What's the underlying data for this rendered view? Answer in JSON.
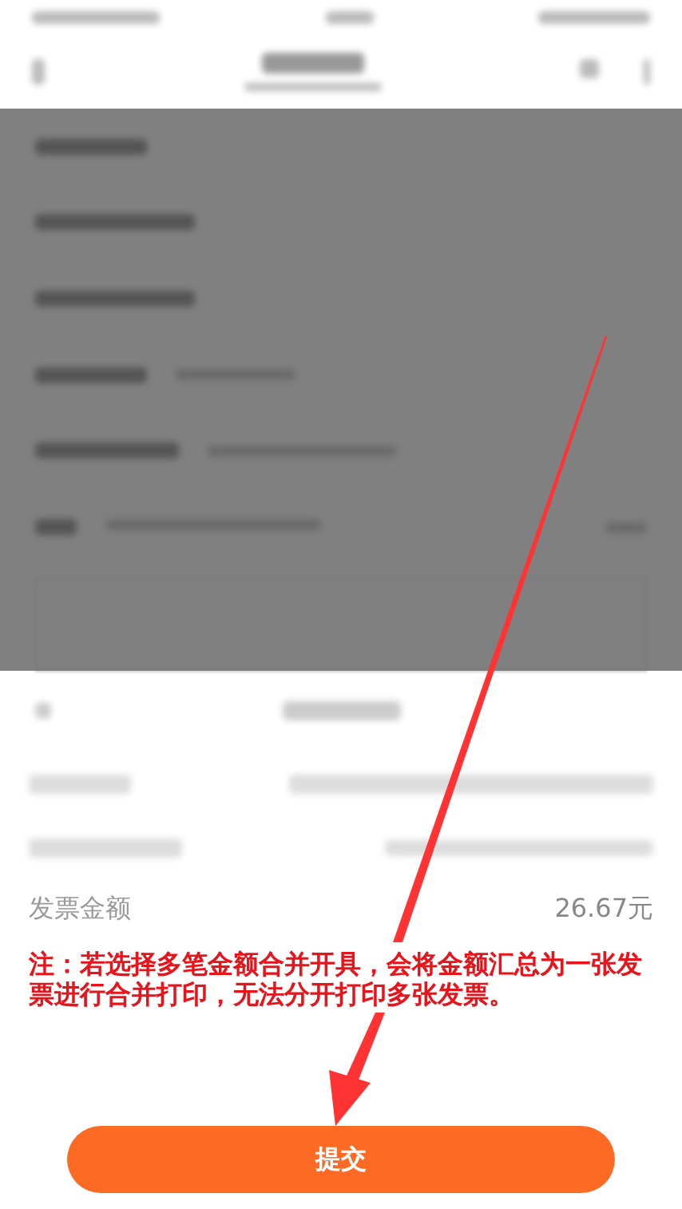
{
  "sheet": {
    "amount_row": {
      "label": "发票金额",
      "value": "26.67元"
    },
    "note": "注：若选择多笔金额合并开具，会将金额汇总为一张发票进行合并打印，无法分开打印多张发票。",
    "submit_button": "提交"
  }
}
